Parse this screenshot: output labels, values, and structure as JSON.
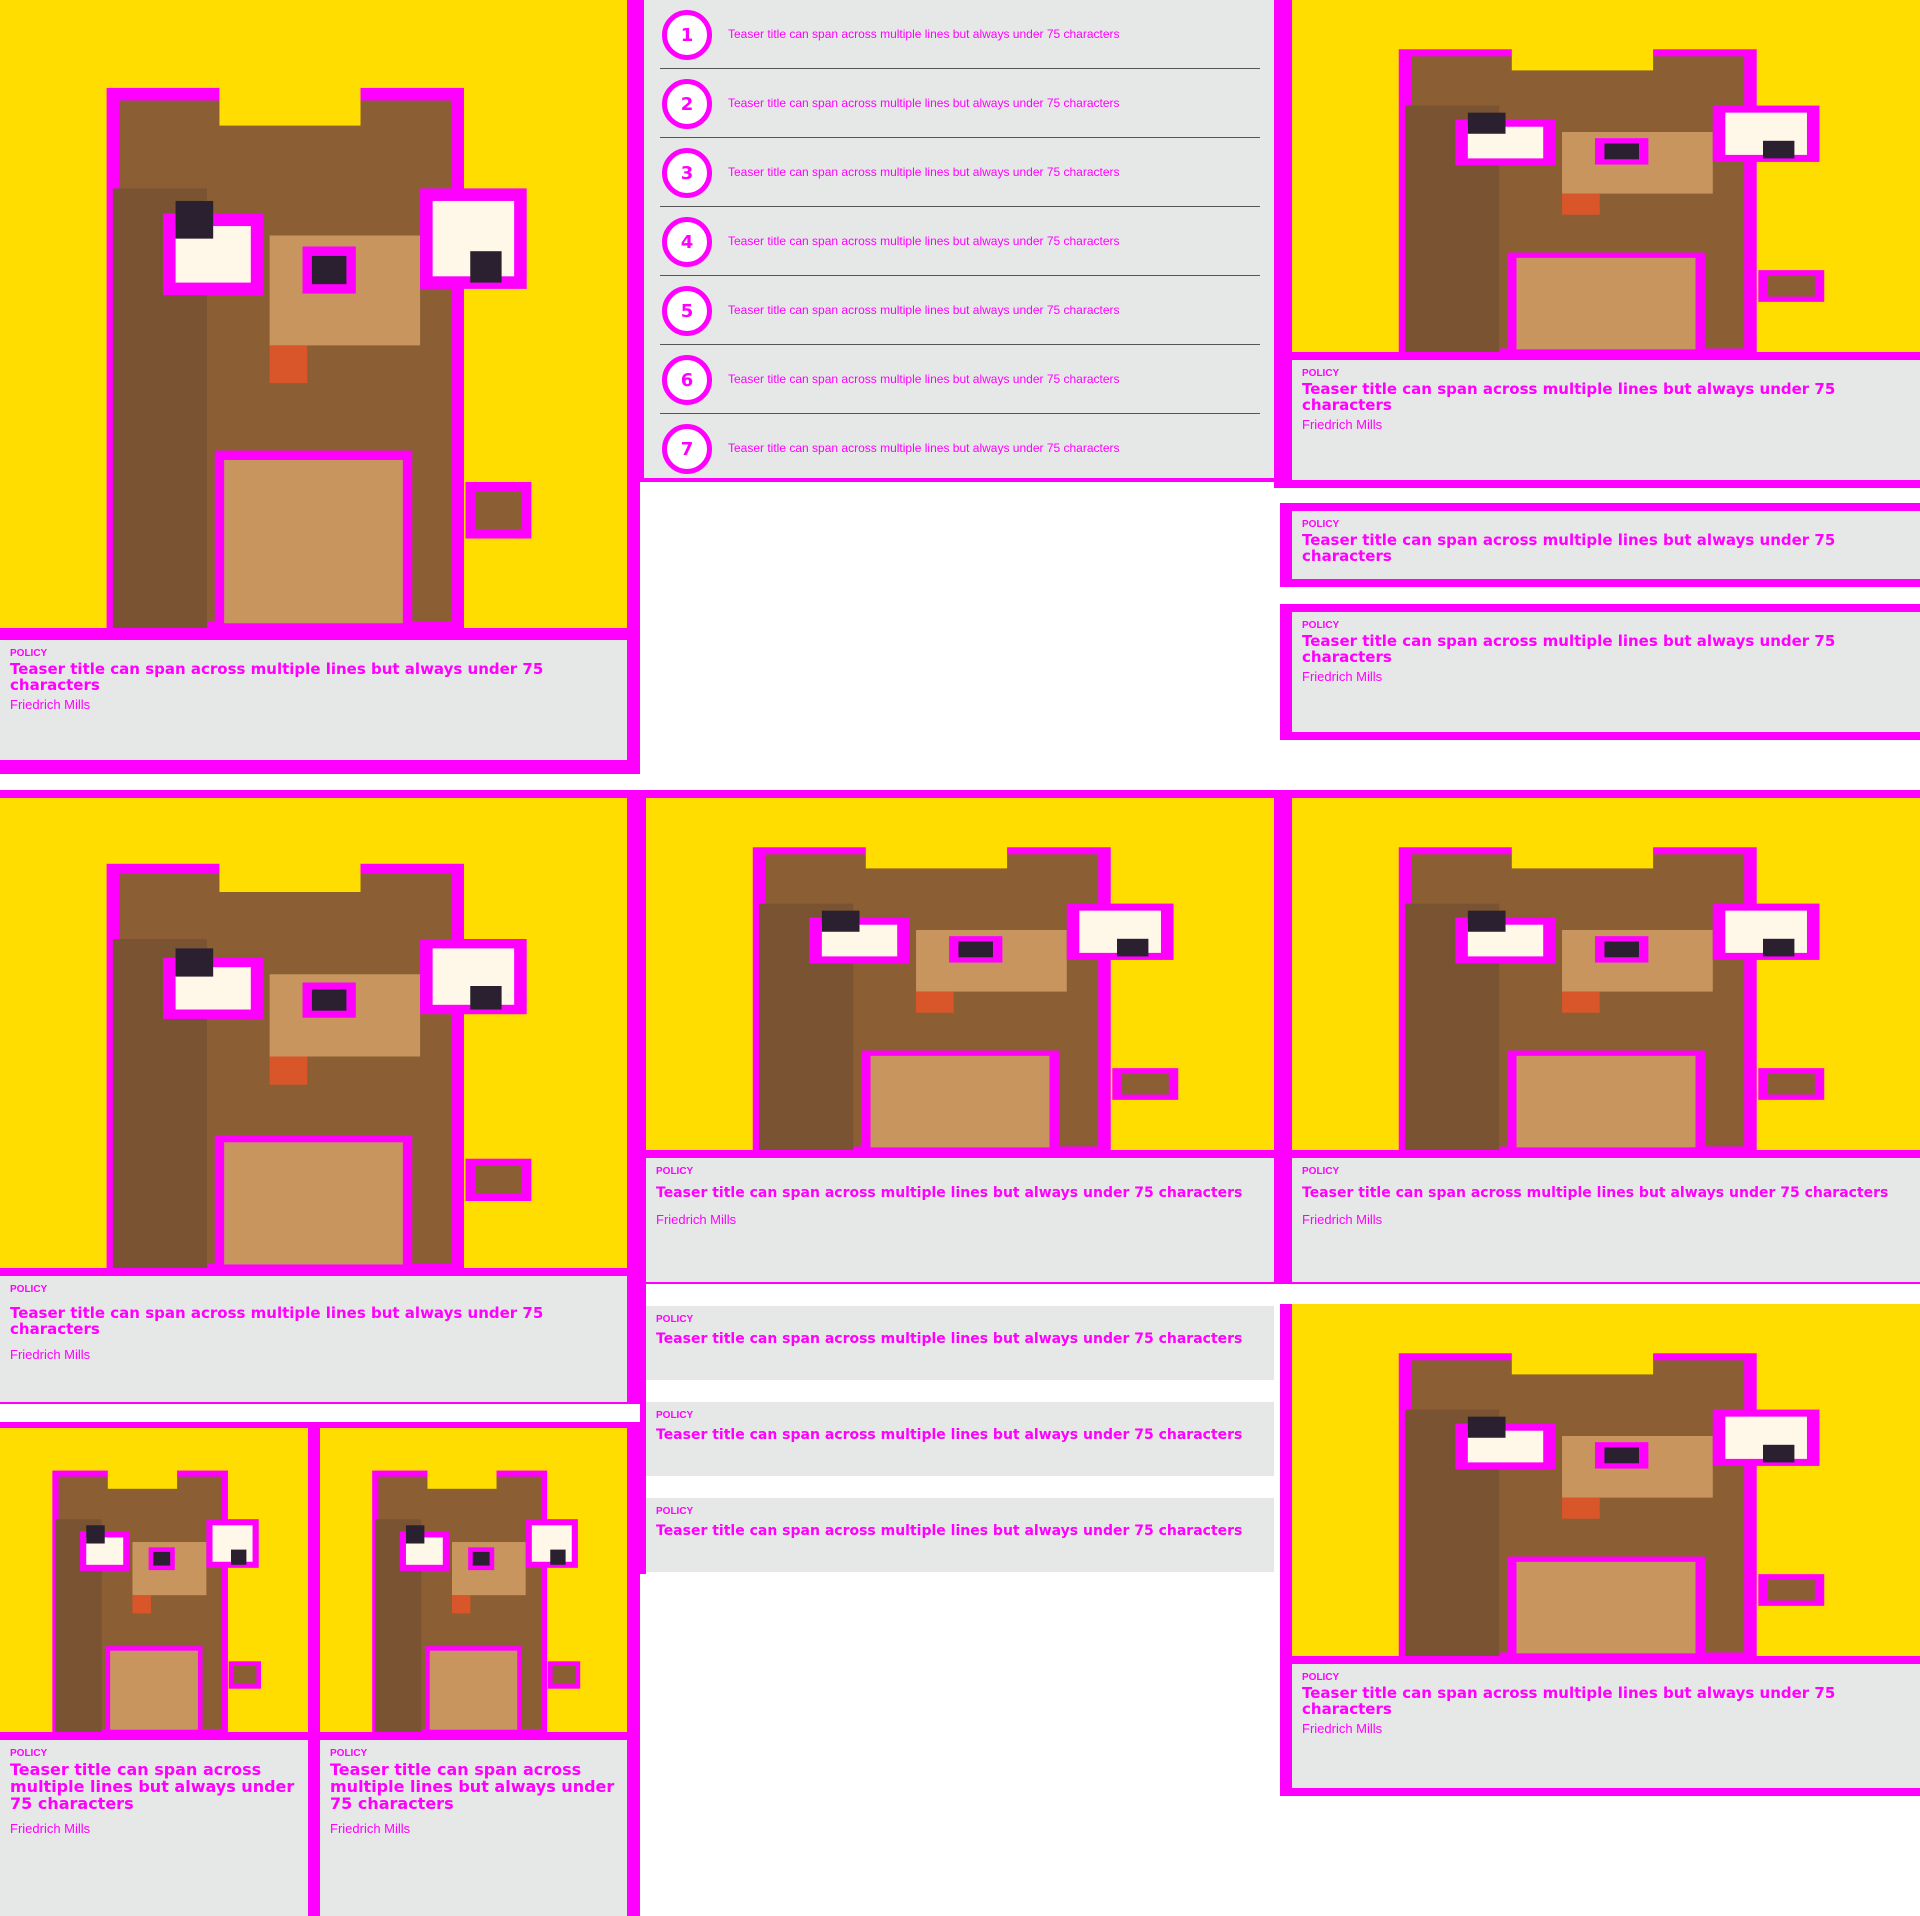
{
  "colors": {
    "accent": "#ff00ff",
    "background_card": "#e6e8e8",
    "image_bg": "#ffdd00"
  },
  "teaser": {
    "kicker": "POLICY",
    "title": "Teaser title can span across multiple lines but always under 75 characters",
    "author": "Friedrich Mills"
  },
  "numbered": {
    "items": [
      {
        "num": "1",
        "title": "Teaser title can span across multiple lines but always under 75 characters"
      },
      {
        "num": "2",
        "title": "Teaser title can span across multiple lines but always under 75 characters"
      },
      {
        "num": "3",
        "title": "Teaser title can span across multiple lines but always under 75 characters"
      },
      {
        "num": "4",
        "title": "Teaser title can span across multiple lines but always under 75 characters"
      },
      {
        "num": "5",
        "title": "Teaser title can span across multiple lines but always under 75 characters"
      },
      {
        "num": "6",
        "title": "Teaser title can span across multiple lines but always under 75 characters"
      },
      {
        "num": "7",
        "title": "Teaser title can span across multiple lines but always under 75 characters"
      }
    ]
  },
  "image": {
    "icon": "pixel-bear-illustration"
  }
}
